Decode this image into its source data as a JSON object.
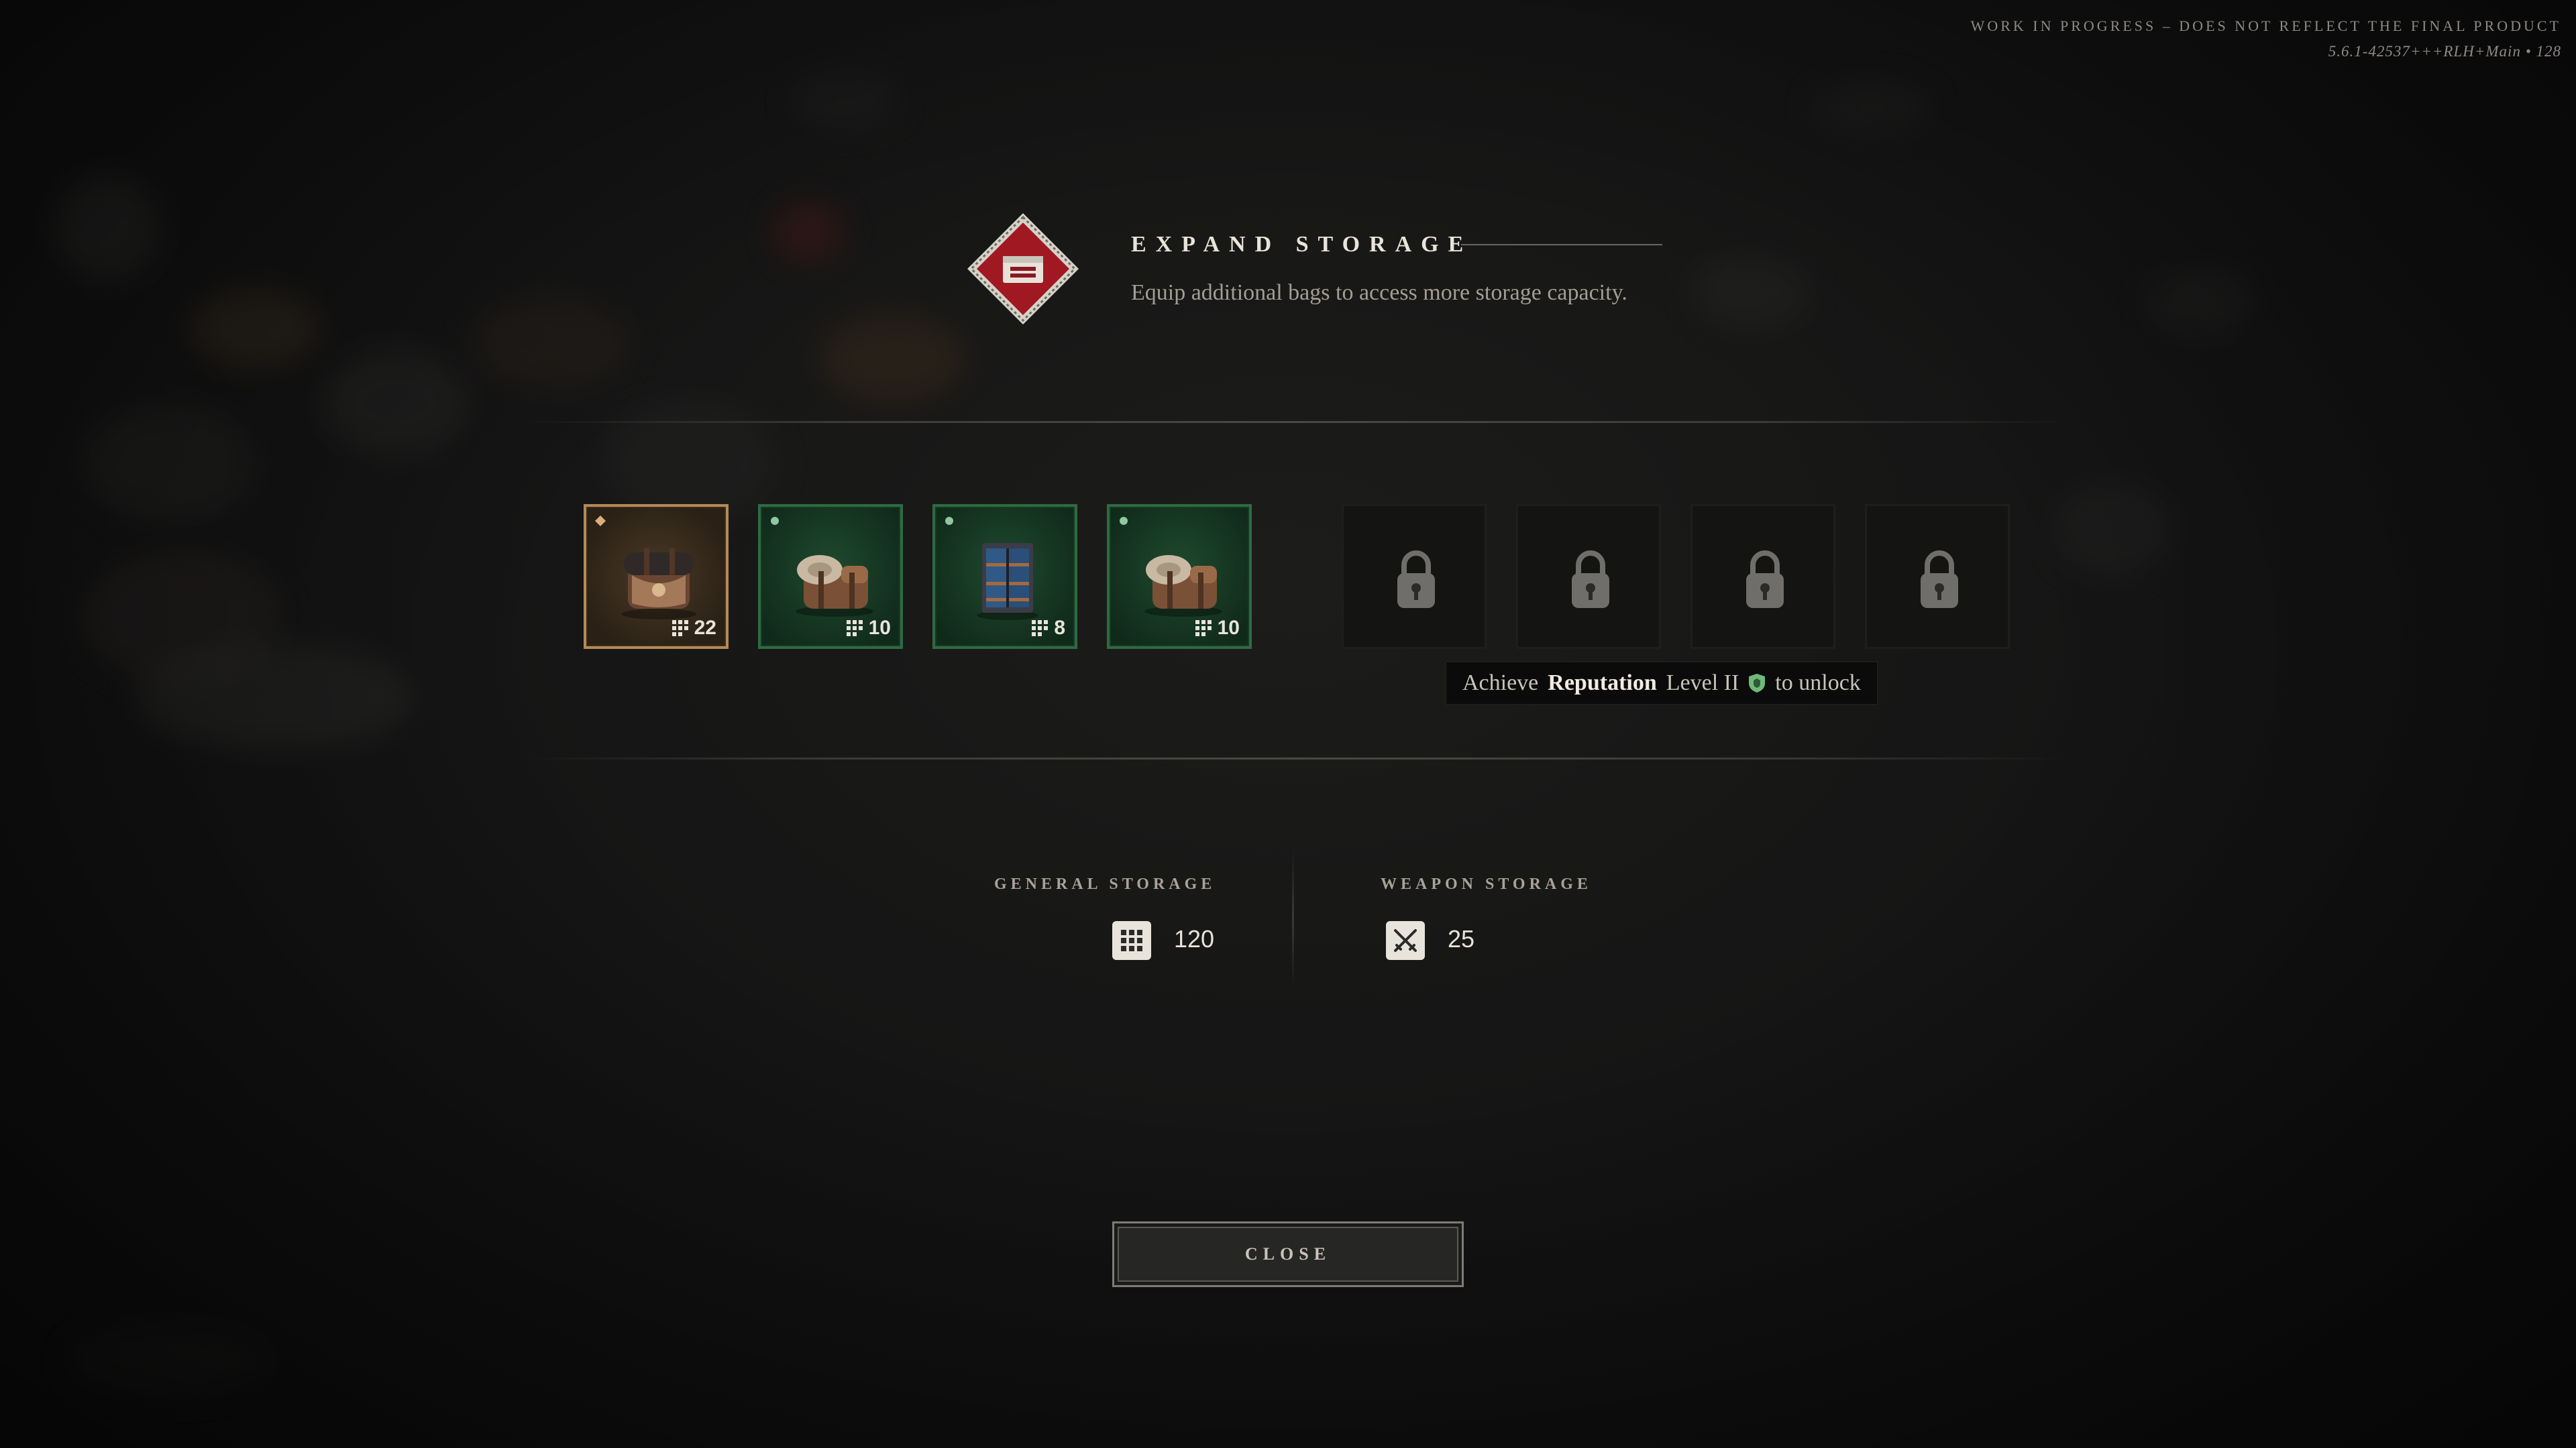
{
  "build": {
    "notice": "WORK IN PROGRESS – DOES NOT REFLECT THE FINAL PRODUCT",
    "version": "5.6.1-42537+++RLH+Main • 128"
  },
  "header": {
    "title": "EXPAND STORAGE",
    "subtitle": "Equip additional bags to access more storage capacity.",
    "emblem_icon": "storage-emblem-icon",
    "accent": "#a01822"
  },
  "bags": [
    {
      "capacity": "22",
      "rarity": "gold",
      "icon": "leather-satchel-icon"
    },
    {
      "capacity": "10",
      "rarity": "green",
      "icon": "bedroll-bag-icon"
    },
    {
      "capacity": "8",
      "rarity": "green",
      "icon": "cabinet-bag-icon"
    },
    {
      "capacity": "10",
      "rarity": "green",
      "icon": "bedroll-bag-icon"
    }
  ],
  "locked_slots": 4,
  "unlock_hint": {
    "prefix": "Achieve",
    "reputation": "Reputation",
    "level": "Level II",
    "suffix": "to unlock"
  },
  "storage": {
    "general_label": "GENERAL STORAGE",
    "general_value": "120",
    "weapon_label": "WEAPON STORAGE",
    "weapon_value": "25"
  },
  "close_label": "CLOSE",
  "colors": {
    "gold_border": "#b58a55",
    "green_border": "#2f6a43",
    "reputation_green": "#6fb97a"
  }
}
